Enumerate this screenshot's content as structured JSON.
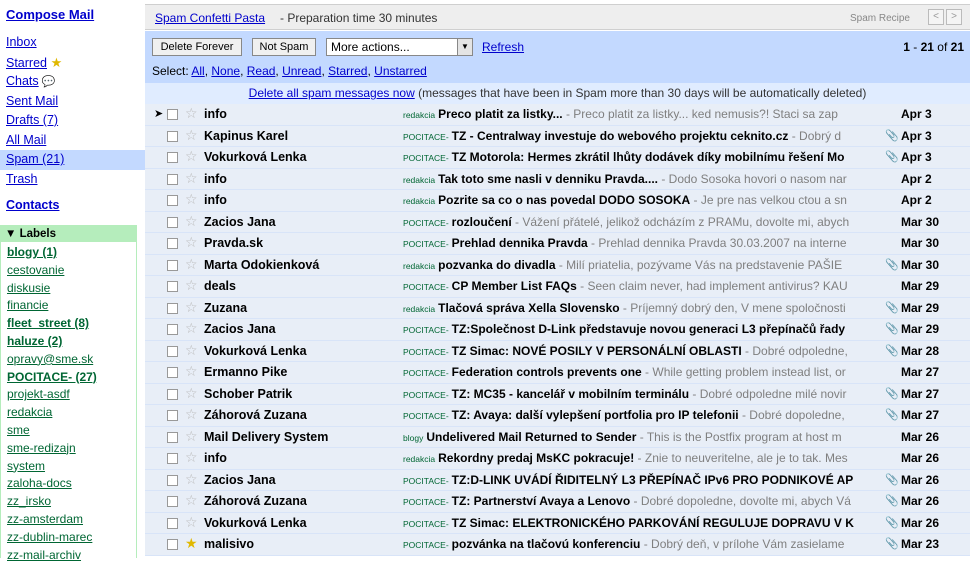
{
  "nav": {
    "compose": "Compose Mail",
    "items": [
      {
        "label": "Inbox",
        "bold": false,
        "selected": false,
        "icon": ""
      },
      {
        "label": "Starred",
        "bold": false,
        "selected": false,
        "icon": "star-icon"
      },
      {
        "label": "Chats",
        "bold": false,
        "selected": false,
        "icon": "chat-bubble-icon"
      },
      {
        "label": "Sent Mail",
        "bold": false,
        "selected": false,
        "icon": ""
      },
      {
        "label": "Drafts (7)",
        "bold": true,
        "selected": false,
        "icon": ""
      },
      {
        "label": "All Mail",
        "bold": false,
        "selected": false,
        "icon": ""
      },
      {
        "label": "Spam (21)",
        "bold": true,
        "selected": true,
        "icon": ""
      },
      {
        "label": "Trash",
        "bold": false,
        "selected": false,
        "icon": ""
      }
    ],
    "contacts": "Contacts",
    "labels_header": "Labels",
    "labels": [
      {
        "label": "blogy (1)",
        "bold": true
      },
      {
        "label": "cestovanie",
        "bold": false
      },
      {
        "label": "diskusie",
        "bold": false
      },
      {
        "label": "financie",
        "bold": false
      },
      {
        "label": "fleet_street (8)",
        "bold": true
      },
      {
        "label": "haluze (2)",
        "bold": true
      },
      {
        "label": "opravy@sme.sk",
        "bold": false
      },
      {
        "label": "POCITACE- (27)",
        "bold": true
      },
      {
        "label": "projekt-asdf",
        "bold": false
      },
      {
        "label": "redakcia",
        "bold": false
      },
      {
        "label": "sme",
        "bold": false
      },
      {
        "label": "sme-redizajn",
        "bold": false
      },
      {
        "label": "system",
        "bold": false
      },
      {
        "label": "zaloha-docs",
        "bold": false
      },
      {
        "label": "zz_irsko",
        "bold": false
      },
      {
        "label": "zz-amsterdam",
        "bold": false
      },
      {
        "label": "zz-dublin-marec",
        "bold": false
      },
      {
        "label": "zz-mail-archiv",
        "bold": false
      }
    ]
  },
  "topbar": {
    "recipe_title": "Spam Confetti Pasta",
    "recipe_sub": "- Preparation time 30 minutes",
    "recipe_label": "Spam Recipe",
    "prev": "<",
    "next": ">"
  },
  "actions": {
    "delete_forever": "Delete Forever",
    "not_spam": "Not Spam",
    "more_actions": "More actions...",
    "refresh": "Refresh",
    "count_range": "1",
    "count_dash": " - ",
    "count_to": "21",
    "count_of": " of ",
    "count_total": "21",
    "select_label": "Select:",
    "select_all": "All",
    "select_none": "None",
    "select_read": "Read",
    "select_unread": "Unread",
    "select_starred": "Starred",
    "select_unstarred": "Unstarred"
  },
  "notice": {
    "link": "Delete all spam messages now",
    "rest": "(messages that have been in Spam more than 30 days will be automatically deleted)"
  },
  "messages": [
    {
      "sender": "info",
      "tag": "redakcia",
      "subject": "Preco platit za listky...",
      "snippet": " - Preco platit za listky... ked nemusis?! Staci sa zap",
      "date": "Apr 3",
      "attach": false,
      "starred": false,
      "pointer": true
    },
    {
      "sender": "Kapinus Karel",
      "tag": "POCITACE-",
      "subject": "TZ - Centralway investuje do webového projektu ceknito.cz",
      "snippet": " - Dobrý d",
      "date": "Apr 3",
      "attach": true,
      "starred": false,
      "pointer": false
    },
    {
      "sender": "Vokurková Lenka",
      "tag": "POCITACE-",
      "subject": "TZ Motorola: Hermes zkrátil lhůty dodávek díky mobilnímu řešení Mo",
      "snippet": "",
      "date": "Apr 3",
      "attach": true,
      "starred": false,
      "pointer": false
    },
    {
      "sender": "info",
      "tag": "redakcia",
      "subject": "Tak toto sme nasli v denniku Pravda....",
      "snippet": " - Dodo Sosoka hovori o nasom nar",
      "date": "Apr 2",
      "attach": false,
      "starred": false,
      "pointer": false
    },
    {
      "sender": "info",
      "tag": "redakcia",
      "subject": "Pozrite sa co o nas povedal DODO SOSOKA",
      "snippet": " - Je pre nas velkou ctou a sn",
      "date": "Apr 2",
      "attach": false,
      "starred": false,
      "pointer": false
    },
    {
      "sender": "Zacios Jana",
      "tag": "POCITACE-",
      "subject": "rozloučení",
      "snippet": " - Vážení přátelé, jelikož odcházím z PRAMu, dovolte mi, abych",
      "date": "Mar 30",
      "attach": false,
      "starred": false,
      "pointer": false
    },
    {
      "sender": "Pravda.sk",
      "tag": "POCITACE-",
      "subject": "Prehlad dennika Pravda",
      "snippet": " - Prehlad dennika Pravda 30.03.2007 na interne",
      "date": "Mar 30",
      "attach": false,
      "starred": false,
      "pointer": false
    },
    {
      "sender": "Marta Odokienková",
      "tag": "redakcia",
      "subject": "pozvanka do divadla",
      "snippet": " - Milí priatelia, pozývame Vás na predstavenie PAŠIE",
      "date": "Mar 30",
      "attach": true,
      "starred": false,
      "pointer": false
    },
    {
      "sender": "deals",
      "tag": "POCITACE-",
      "subject": "CP Member List FAQs",
      "snippet": " - Seen claim never, had implement antivirus? KAU",
      "date": "Mar 29",
      "attach": false,
      "starred": false,
      "pointer": false
    },
    {
      "sender": "Zuzana",
      "tag": "redakcia",
      "subject": "Tlačová správa Xella Slovensko",
      "snippet": " - Príjemný dobrý den, V mene spoločnosti",
      "date": "Mar 29",
      "attach": true,
      "starred": false,
      "pointer": false
    },
    {
      "sender": "Zacios Jana",
      "tag": "POCITACE-",
      "subject": "TZ:Společnost D-Link představuje novou generaci L3 přepínačů řady",
      "snippet": "",
      "date": "Mar 29",
      "attach": true,
      "starred": false,
      "pointer": false
    },
    {
      "sender": "Vokurková Lenka",
      "tag": "POCITACE-",
      "subject": "TZ Simac: NOVÉ POSILY V PERSONÁLNÍ OBLASTI",
      "snippet": " - Dobré odpoledne,",
      "date": "Mar 28",
      "attach": true,
      "starred": false,
      "pointer": false
    },
    {
      "sender": "Ermanno Pike",
      "tag": "POCITACE-",
      "subject": "Federation controls prevents one",
      "snippet": " - While getting problem instead list, or",
      "date": "Mar 27",
      "attach": false,
      "starred": false,
      "pointer": false
    },
    {
      "sender": "Schober Patrik",
      "tag": "POCITACE-",
      "subject": "TZ: MC35 - kancelář v mobilním terminálu",
      "snippet": " - Dobré odpoledne milé novir",
      "date": "Mar 27",
      "attach": true,
      "starred": false,
      "pointer": false
    },
    {
      "sender": "Záhorová Zuzana",
      "tag": "POCITACE-",
      "subject": "TZ: Avaya: další vylepšení portfolia pro IP telefonii",
      "snippet": " - Dobré dopoledne,",
      "date": "Mar 27",
      "attach": true,
      "starred": false,
      "pointer": false
    },
    {
      "sender": "Mail Delivery System",
      "tag": "blogy",
      "subject": "Undelivered Mail Returned to Sender",
      "snippet": " - This is the Postfix program at host m",
      "date": "Mar 26",
      "attach": false,
      "starred": false,
      "pointer": false
    },
    {
      "sender": "info",
      "tag": "redakcia",
      "subject": "Rekordny predaj MsKC pokracuje!",
      "snippet": " - Znie to neuveritelne, ale je to tak. Mes",
      "date": "Mar 26",
      "attach": false,
      "starred": false,
      "pointer": false
    },
    {
      "sender": "Zacios Jana",
      "tag": "POCITACE-",
      "subject": "TZ:D-LINK UVÁDÍ ŘIDITELNÝ L3 PŘEPÍNAČ IPv6 PRO PODNIKOVÉ AP",
      "snippet": "",
      "date": "Mar 26",
      "attach": true,
      "starred": false,
      "pointer": false
    },
    {
      "sender": "Záhorová Zuzana",
      "tag": "POCITACE-",
      "subject": "TZ: Partnerství Avaya a Lenovo",
      "snippet": " - Dobré dopoledne, dovolte mi, abych Vá",
      "date": "Mar 26",
      "attach": true,
      "starred": false,
      "pointer": false
    },
    {
      "sender": "Vokurková Lenka",
      "tag": "POCITACE-",
      "subject": "TZ Simac: ELEKTRONICKÉHO PARKOVÁNÍ REGULUJE DOPRAVU V K",
      "snippet": "",
      "date": "Mar 26",
      "attach": true,
      "starred": false,
      "pointer": false
    },
    {
      "sender": "malisivo",
      "tag": "POCITACE-",
      "subject": "pozvánka na tlačovú konferenciu",
      "snippet": " - Dobrý deň, v prílohe Vám zasielame",
      "date": "Mar 23",
      "attach": true,
      "starred": true,
      "pointer": false
    }
  ]
}
